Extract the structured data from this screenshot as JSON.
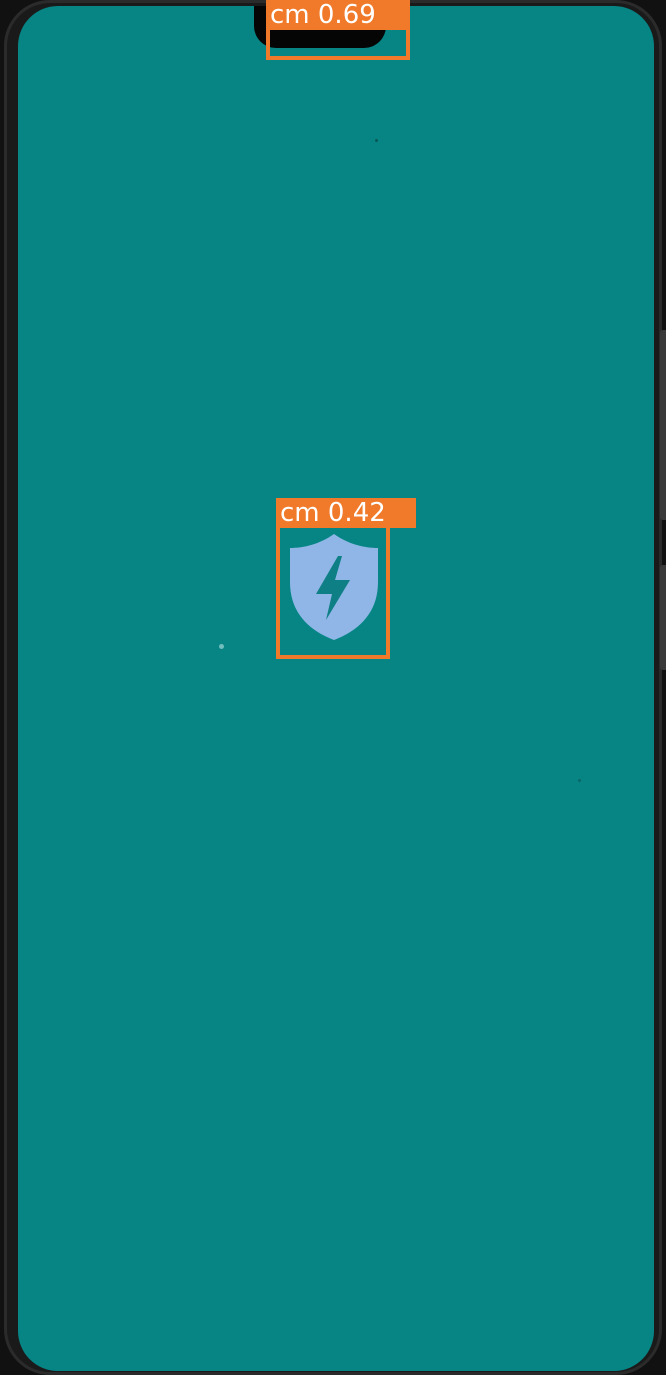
{
  "screen": {
    "background_color": "#078585"
  },
  "detections": [
    {
      "label": "cm",
      "score": "0.69"
    },
    {
      "label": "cm",
      "score": "0.42"
    }
  ],
  "app_icon": {
    "icon": "shield-bolt-icon",
    "shield_color": "#8fb6e6",
    "bolt_color": "#0f7f86"
  },
  "colors": {
    "box_color": "#f07a2a"
  }
}
